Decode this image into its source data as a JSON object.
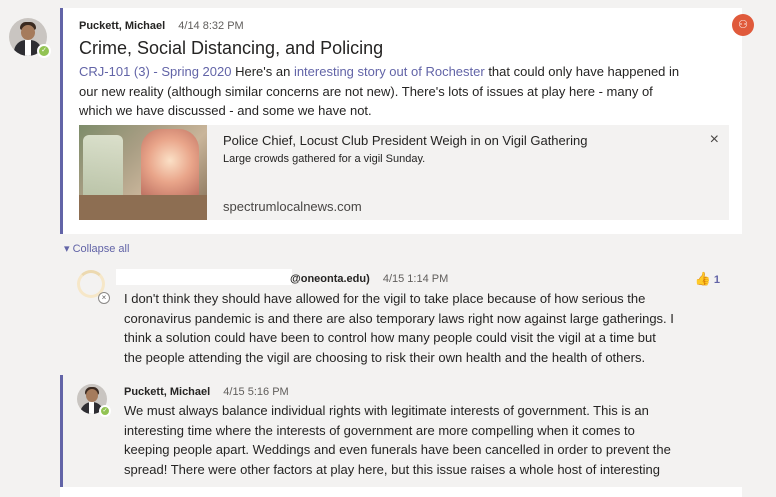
{
  "post": {
    "author": "Puckett, Michael",
    "time": "4/14 8:32 PM",
    "subject": "Crime, Social Distancing, and Policing",
    "tag": "CRJ-101 (3) - Spring 2020",
    "text_1": " Here's an ",
    "link": "interesting story out of Rochester",
    "text_2": " that could only have happened in",
    "line_2": "our new reality (although similar concerns are not new). There's lots of issues at play here - many of",
    "line_3": "which we have discussed - and some we have not.",
    "preview": {
      "title": "Police Chief, Locust Club President Weigh in on Vigil Gathering",
      "description": "Large crowds gathered for a vigil Sunday.",
      "url": "spectrumlocalnews.com",
      "close_icon": "×"
    }
  },
  "collapse_label": "Collapse all",
  "reply_1": {
    "author_suffix": "@oneonta.edu)",
    "time": "4/15 1:14 PM",
    "like_count": "1",
    "lines": [
      "I don't think they should have allowed for the vigil to take place because of how serious the",
      "coronavirus pandemic is and there are also temporary laws right now against large gatherings. I",
      "think a solution could have been to control how many people could visit the vigil at a time but",
      "the people attending the vigil are choosing to risk their own health and the health of others."
    ]
  },
  "reply_2": {
    "author": "Puckett, Michael",
    "time": "4/15 5:16 PM",
    "lines": [
      "We must always balance individual rights with legitimate interests of government. This is an",
      "interesting time where the interests of government are more compelling when it comes to",
      "keeping people apart. Weddings and even funerals have been cancelled in order to prevent the",
      "spread! There were other factors at play here, but this issue raises a whole host of interesting"
    ]
  },
  "icons": {
    "presence": "checkmark-icon",
    "like": "thumbs-up-icon",
    "team": "team-icon"
  }
}
